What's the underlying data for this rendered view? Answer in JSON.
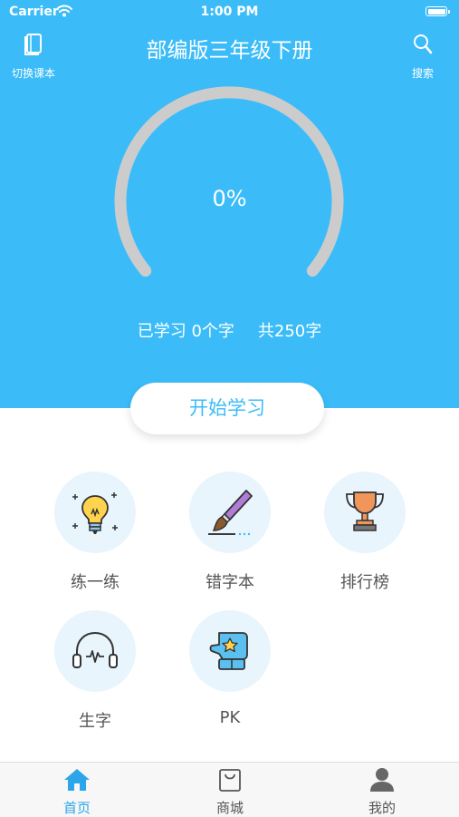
{
  "status_bar": {
    "carrier": "Carrier",
    "time": "1:00 PM"
  },
  "header": {
    "title": "部编版三年级下册",
    "left_button": {
      "label": "切换课本",
      "icon": "book-icon"
    },
    "right_button": {
      "label": "搜索",
      "icon": "search-icon"
    }
  },
  "progress": {
    "percent_label": "0%",
    "value": 0,
    "learned": "已学习 0个字",
    "total": "共250字"
  },
  "start_button": {
    "label": "开始学习"
  },
  "features": [
    {
      "label": "练一练",
      "icon": "lightbulb-icon"
    },
    {
      "label": "错字本",
      "icon": "paintbrush-icon"
    },
    {
      "label": "排行榜",
      "icon": "trophy-icon"
    },
    {
      "label": "生字",
      "icon": "headphones-icon"
    },
    {
      "label": "PK",
      "icon": "boxing-glove-icon"
    }
  ],
  "tabbar": [
    {
      "label": "首页",
      "icon": "home-icon",
      "active": true
    },
    {
      "label": "商城",
      "icon": "shopping-bag-icon",
      "active": false
    },
    {
      "label": "我的",
      "icon": "user-icon",
      "active": false
    }
  ],
  "colors": {
    "primary": "#3bbcf8",
    "gauge_track": "#cccccc",
    "tab_active": "#2ba6e8",
    "icon_background": "#e8f5fd"
  }
}
